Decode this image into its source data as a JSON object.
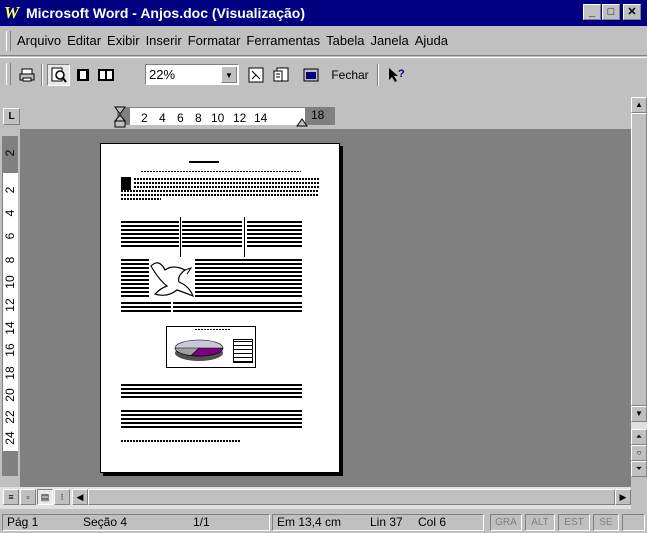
{
  "window": {
    "title": "Microsoft Word - Anjos.doc (Visualização)",
    "app_icon": "W"
  },
  "menu": [
    "Arquivo",
    "Editar",
    "Exibir",
    "Inserir",
    "Formatar",
    "Ferramentas",
    "Tabela",
    "Janela",
    "Ajuda"
  ],
  "toolbar": {
    "zoom_value": "22%",
    "close_label": "Fechar"
  },
  "hruler": {
    "ticks": [
      "2",
      "4",
      "6",
      "8",
      "10",
      "12",
      "14"
    ],
    "right_tick": "18"
  },
  "vruler": {
    "top_tick": "2",
    "ticks": [
      "2",
      "4",
      "6",
      "8",
      "10",
      "12",
      "14",
      "16",
      "18",
      "20",
      "22",
      "24"
    ]
  },
  "statusbar": {
    "page": "Pág 1",
    "section": "Seção 4",
    "pages": "1/1",
    "position": "Em 13,4 cm",
    "line": "Lin 37",
    "column": "Col 6",
    "modes": [
      "GRA",
      "ALT",
      "EST",
      "SE"
    ]
  }
}
